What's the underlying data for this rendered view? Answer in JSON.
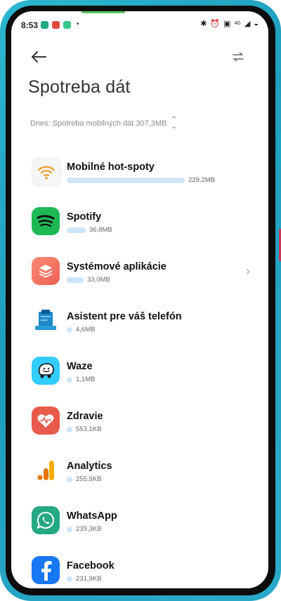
{
  "status_bar": {
    "time": "8:53",
    "network": "4G"
  },
  "header": {
    "title": "Spotreba dát",
    "summary": "Dnes: Spotreba mobilných dát 307,3MB"
  },
  "apps": [
    {
      "name": "Mobilné hot-spoty",
      "usage": "229,2MB",
      "share": 1.0,
      "icon": "wifi-hotspot-icon"
    },
    {
      "name": "Spotify",
      "usage": "36,8MB",
      "share": 0.16,
      "icon": "spotify-icon"
    },
    {
      "name": "Systémové aplikácie",
      "usage": "33,0MB",
      "share": 0.14,
      "icon": "system-apps-icon",
      "has_details": true
    },
    {
      "name": "Asistent pre váš telefón",
      "usage": "4,6MB",
      "share": 0.03,
      "icon": "phone-assistant-icon"
    },
    {
      "name": "Waze",
      "usage": "1,1MB",
      "share": 0.02,
      "icon": "waze-icon"
    },
    {
      "name": "Zdravie",
      "usage": "553,1KB",
      "share": 0.02,
      "icon": "health-icon"
    },
    {
      "name": "Analytics",
      "usage": "255,5KB",
      "share": 0.02,
      "icon": "analytics-icon"
    },
    {
      "name": "WhatsApp",
      "usage": "239,3KB",
      "share": 0.02,
      "icon": "whatsapp-icon"
    },
    {
      "name": "Facebook",
      "usage": "231,9KB",
      "share": 0.02,
      "icon": "facebook-icon"
    }
  ],
  "colors": {
    "frame": "#1f9fbd",
    "bar": "#cfe6f8",
    "spotify": "#1db954",
    "system": "#f06f5c",
    "waze": "#33ccff",
    "health": "#e85b4c",
    "whatsapp": "#25a884",
    "facebook": "#1877f2"
  }
}
